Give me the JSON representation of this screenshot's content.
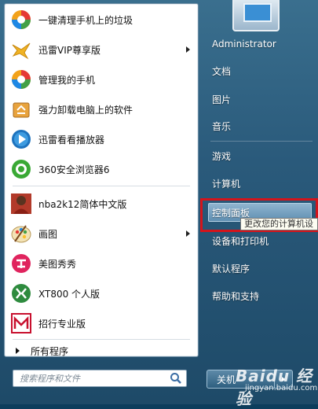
{
  "programs": [
    {
      "label": "一键清理手机上的垃圾",
      "icon": "colorful-ball-icon",
      "arrow": false
    },
    {
      "label": "迅雷VIP尊享版",
      "icon": "xunlei-bird-icon",
      "arrow": true
    },
    {
      "label": "管理我的手机",
      "icon": "colorful-ball-icon",
      "arrow": false
    },
    {
      "label": "强力卸载电脑上的软件",
      "icon": "recycle-box-icon",
      "arrow": false
    },
    {
      "label": "迅雷看看播放器",
      "icon": "blue-play-icon",
      "arrow": false
    },
    {
      "label": "360安全浏览器6",
      "icon": "browser-360-icon",
      "arrow": false
    },
    {
      "label": "nba2k12简体中文版",
      "icon": "nba-player-icon",
      "arrow": false
    },
    {
      "label": "画图",
      "icon": "paint-palette-icon",
      "arrow": true
    },
    {
      "label": "美图秀秀",
      "icon": "meitu-icon",
      "arrow": false
    },
    {
      "label": "XT800 个人版",
      "icon": "xt800-icon",
      "arrow": false
    },
    {
      "label": "招行专业版",
      "icon": "cmb-bank-icon",
      "arrow": false
    }
  ],
  "all_programs": "所有程序",
  "search": {
    "placeholder": "搜索程序和文件"
  },
  "right_menu": {
    "user": "Administrator",
    "documents": "文档",
    "pictures": "图片",
    "music": "音乐",
    "games": "游戏",
    "computer": "计算机",
    "control_panel": "控制面板",
    "devices": "设备和打印机",
    "default_programs": "默认程序",
    "help": "帮助和支持"
  },
  "tooltip": "更改您的计算机设",
  "shutdown_label": "关机",
  "watermark": {
    "brand": "Baidu 经验",
    "url": "jingyan.baidu.com"
  },
  "colors": {
    "highlight": "#d4141b",
    "menu_bg": "#2a5a7b"
  }
}
